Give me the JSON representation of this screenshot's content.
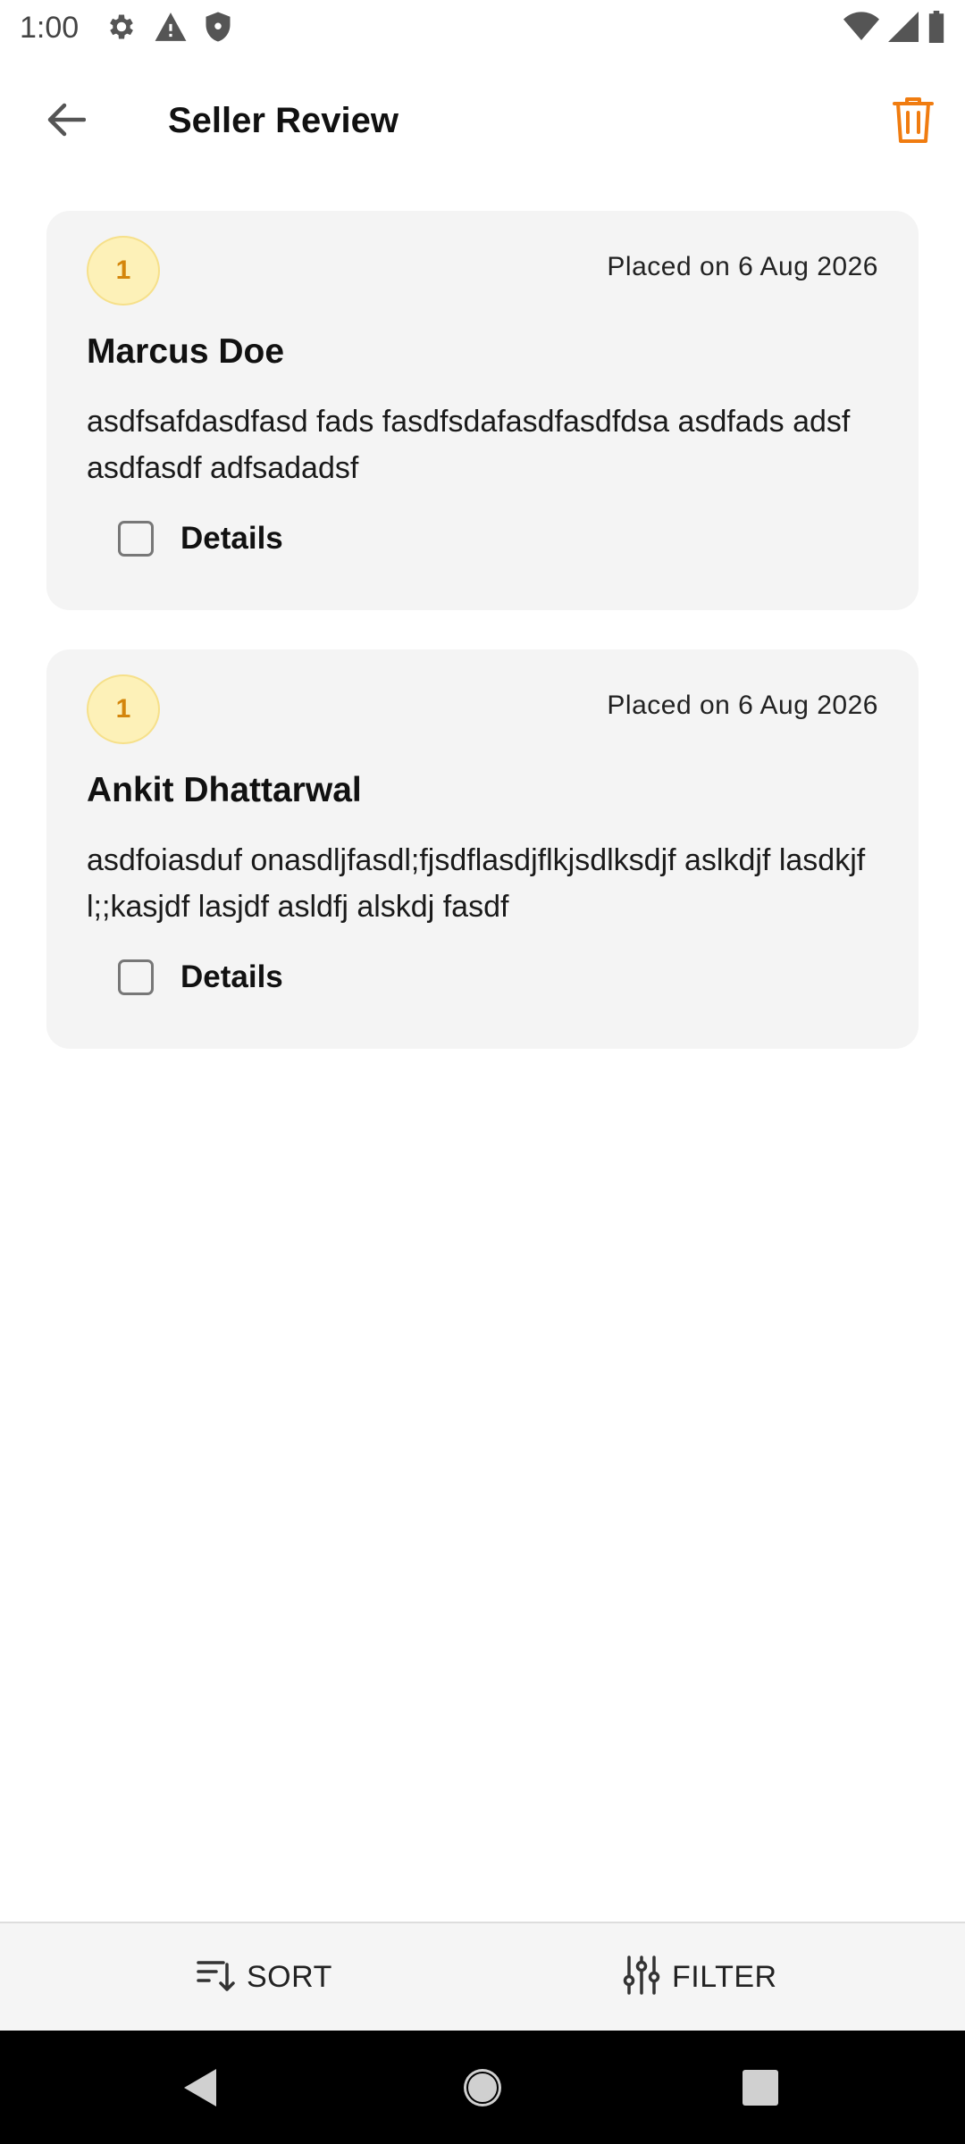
{
  "status_bar": {
    "time": "1:00",
    "left_icons": [
      "settings-icon",
      "warning-icon",
      "shield-icon"
    ],
    "right_icons": [
      "wifi-icon",
      "signal-icon",
      "battery-icon"
    ]
  },
  "app_bar": {
    "title": "Seller Review",
    "back_icon": "arrow-left-icon",
    "action_icon": "trash-icon"
  },
  "colors": {
    "accent": "#f07c10",
    "card_bg": "#f4f4f4",
    "badge_bg": "#fdf1b8",
    "badge_text": "#d4860c"
  },
  "reviews": [
    {
      "rating": "1",
      "date": "Placed on 6 Aug 2026",
      "name": "Marcus Doe",
      "text": "asdfsafdasdfasd fads fasdfsdafasdfasdfdsa asdfads adsf asdfasdf adfsadadsf",
      "details_label": "Details",
      "details_checked": false
    },
    {
      "rating": "1",
      "date": "Placed on 6 Aug 2026",
      "name": "Ankit Dhattarwal",
      "text": "asdfoiasduf onasdljfasdl;fjsdflasdjflkjsdlksdjf aslkdjf lasdkjf l;;kasjdf lasjdf asldfj alskdj fasdf",
      "details_label": "Details",
      "details_checked": false
    }
  ],
  "bottom_bar": {
    "sort_label": "SORT",
    "filter_label": "FILTER"
  }
}
